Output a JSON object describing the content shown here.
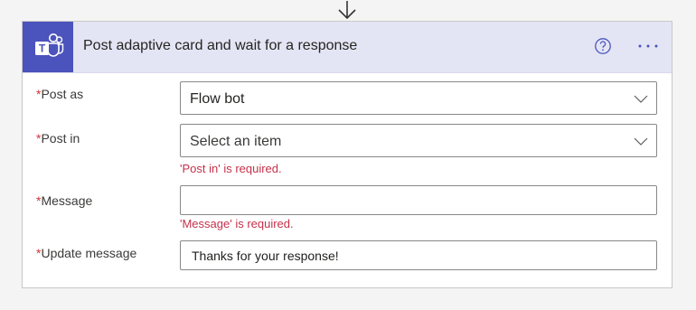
{
  "action": {
    "title": "Post adaptive card and wait for a response",
    "teams_logo_letter": "T",
    "help_icon": "question-circle-icon",
    "more_icon": "ellipsis-icon",
    "colors": {
      "header_bg": "#e4e5f4",
      "icon_bg": "#4b53bc",
      "accent": "#4b53bc",
      "error": "#c4314b",
      "required_star": "#d13438"
    }
  },
  "flow_connector": {
    "icon": "arrow-down-icon"
  },
  "fields": {
    "post_as": {
      "required_mark": "*",
      "label": "Post as",
      "value": "Flow bot"
    },
    "post_in": {
      "required_mark": "*",
      "label": "Post in",
      "placeholder": "Select an item",
      "error": "'Post in' is required."
    },
    "message": {
      "required_mark": "*",
      "label": "Message",
      "value": "",
      "error": "'Message' is required."
    },
    "update_message": {
      "required_mark": "*",
      "label": "Update message",
      "value": "Thanks for your response!"
    }
  }
}
